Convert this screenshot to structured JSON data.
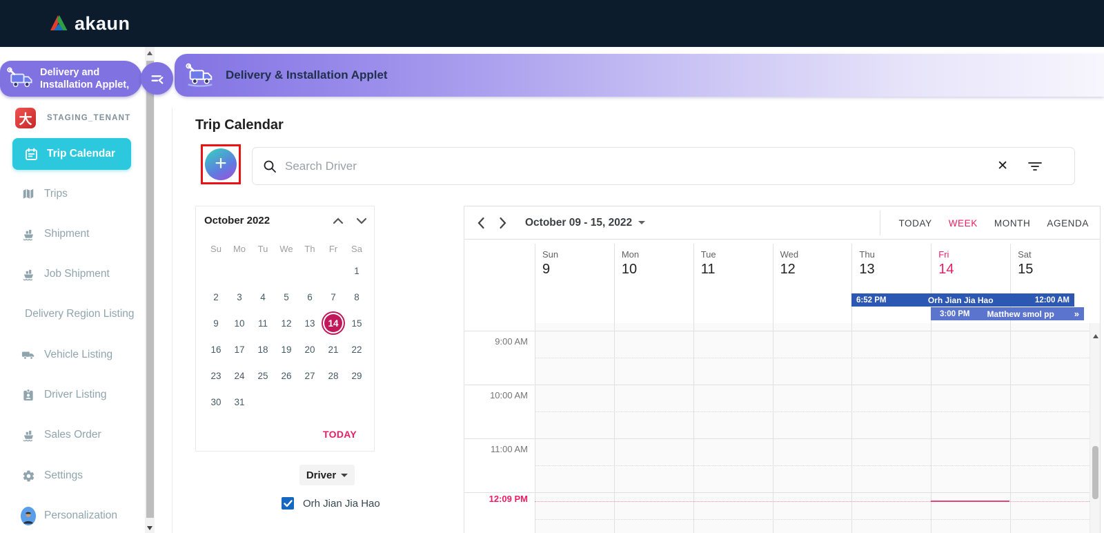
{
  "colors": {
    "navbar_bg": "#0c1c2c",
    "accent_purple": "#8172e2",
    "accent_cyan": "#2cc8de",
    "selected_date_pink": "#c2185b",
    "today_red": "#e91e63",
    "event_dark_blue": "#2c57b2",
    "event_light_blue": "#5b74ce",
    "checkbox_blue": "#1567c0",
    "annotation_red": "#ee1111"
  },
  "navbar": {
    "brand": "akaun"
  },
  "sidebar": {
    "applet_badge": {
      "line1": "Delivery and",
      "line2": "Installation Applet,"
    },
    "tenant_label": "STAGING_TENANT",
    "items": [
      {
        "label": "Trip Calendar",
        "active": true
      },
      {
        "label": "Trips"
      },
      {
        "label": "Shipment"
      },
      {
        "label": "Job Shipment"
      },
      {
        "label": "Delivery Region Listing"
      },
      {
        "label": "Vehicle Listing"
      },
      {
        "label": "Driver Listing"
      },
      {
        "label": "Sales Order"
      },
      {
        "label": "Settings"
      },
      {
        "label": "Personalization"
      }
    ]
  },
  "applet_header": {
    "title": "Delivery & Installation Applet"
  },
  "main": {
    "page_title": "Trip Calendar",
    "add_button_label": "+",
    "search": {
      "placeholder": "Search Driver",
      "clear_icon": "✕"
    },
    "mini_calendar": {
      "title": "October 2022",
      "weekdays": [
        "Su",
        "Mo",
        "Tu",
        "We",
        "Th",
        "Fr",
        "Sa"
      ],
      "weeks": [
        [
          "",
          "",
          "",
          "",
          "",
          "",
          "1"
        ],
        [
          "2",
          "3",
          "4",
          "5",
          "6",
          "7",
          "8"
        ],
        [
          "9",
          "10",
          "11",
          "12",
          "13",
          "14",
          "15"
        ],
        [
          "16",
          "17",
          "18",
          "19",
          "20",
          "21",
          "22"
        ],
        [
          "23",
          "24",
          "25",
          "26",
          "27",
          "28",
          "29"
        ],
        [
          "30",
          "31",
          "",
          "",
          "",
          "",
          ""
        ]
      ],
      "selected_day": "14",
      "today_label": "TODAY"
    },
    "driver_filter": {
      "dropdown_label": "Driver",
      "checkbox_label": "Orh Jian Jia Hao",
      "checked": true
    },
    "week_calendar": {
      "range_label": "October 09 - 15, 2022",
      "views": [
        {
          "label": "TODAY",
          "active": false
        },
        {
          "label": "WEEK",
          "active": true
        },
        {
          "label": "MONTH",
          "active": false
        },
        {
          "label": "AGENDA",
          "active": false
        }
      ],
      "days": [
        {
          "name": "Sun",
          "number": "9"
        },
        {
          "name": "Mon",
          "number": "10"
        },
        {
          "name": "Tue",
          "number": "11"
        },
        {
          "name": "Wed",
          "number": "12"
        },
        {
          "name": "Thu",
          "number": "13"
        },
        {
          "name": "Fri",
          "number": "14",
          "today": true
        },
        {
          "name": "Sat",
          "number": "15"
        }
      ],
      "events": [
        {
          "start": "6:52 PM",
          "title": "Orh Jian Jia Hao",
          "end": "12:00 AM"
        },
        {
          "start": "3:00 PM",
          "title": "Matthew smol pp",
          "more_icon": "»"
        }
      ],
      "time_labels": [
        "9:00 AM",
        "10:00 AM",
        "11:00 AM"
      ],
      "current_time_label": "12:09 PM"
    }
  }
}
